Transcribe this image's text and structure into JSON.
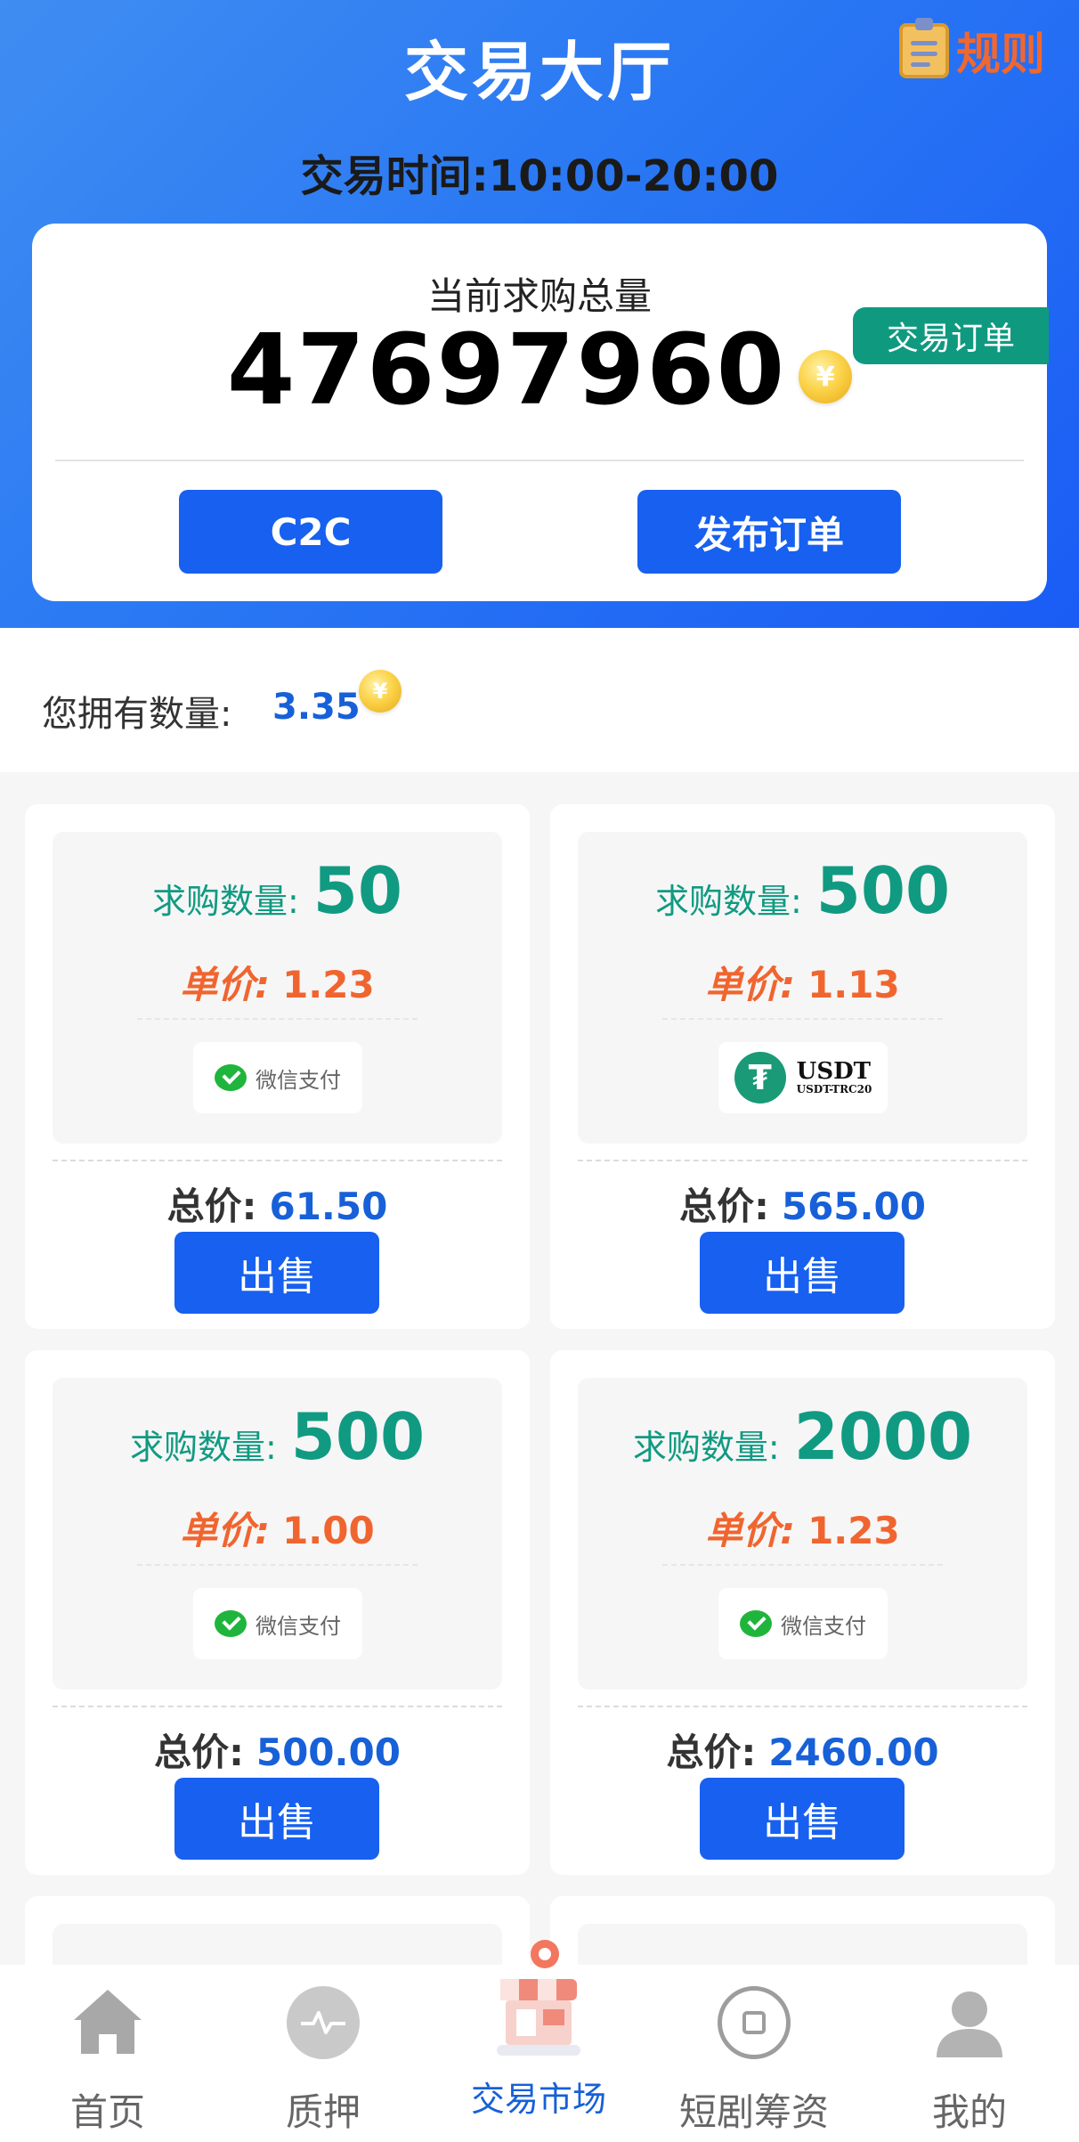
{
  "header": {
    "title": "交易大厅",
    "rules_label": "规则",
    "trade_time": "交易时间:10:00-20:00"
  },
  "summary": {
    "label": "当前求购总量",
    "value": "47697960",
    "coin_symbol": "¥",
    "order_tag": "交易订单",
    "c2c_label": "C2C",
    "publish_label": "发布订单"
  },
  "owned": {
    "label": "您拥有数量:",
    "value": "3.35",
    "coin_symbol": "¥"
  },
  "cards": [
    {
      "qty_label": "求购数量:",
      "qty": "50",
      "price_label": "单价:",
      "price": "1.23",
      "pay": "wechat",
      "pay_label": "微信支付",
      "total_label": "总价:",
      "total": "61.50",
      "sell_label": "出售"
    },
    {
      "qty_label": "求购数量:",
      "qty": "500",
      "price_label": "单价:",
      "price": "1.13",
      "pay": "usdt",
      "pay_label": "USDT",
      "pay_sub": "USDT-TRC20",
      "total_label": "总价:",
      "total": "565.00",
      "sell_label": "出售"
    },
    {
      "qty_label": "求购数量:",
      "qty": "500",
      "price_label": "单价:",
      "price": "1.00",
      "pay": "wechat",
      "pay_label": "微信支付",
      "total_label": "总价:",
      "total": "500.00",
      "sell_label": "出售"
    },
    {
      "qty_label": "求购数量:",
      "qty": "2000",
      "price_label": "单价:",
      "price": "1.23",
      "pay": "wechat",
      "pay_label": "微信支付",
      "total_label": "总价:",
      "total": "2460.00",
      "sell_label": "出售"
    }
  ],
  "nav": {
    "items": [
      {
        "label": "首页",
        "icon": "home-icon"
      },
      {
        "label": "质押",
        "icon": "pulse-icon"
      },
      {
        "label": "交易市场",
        "icon": "market-stall-icon",
        "active": true
      },
      {
        "label": "短剧筹资",
        "icon": "square-circle-icon"
      },
      {
        "label": "我的",
        "icon": "user-icon"
      }
    ]
  },
  "colors": {
    "primary": "#1760f0",
    "teal": "#119a82",
    "orange": "#f0652f",
    "header_gradient_start": "#3f8df2",
    "header_gradient_end": "#1a5cf5"
  }
}
